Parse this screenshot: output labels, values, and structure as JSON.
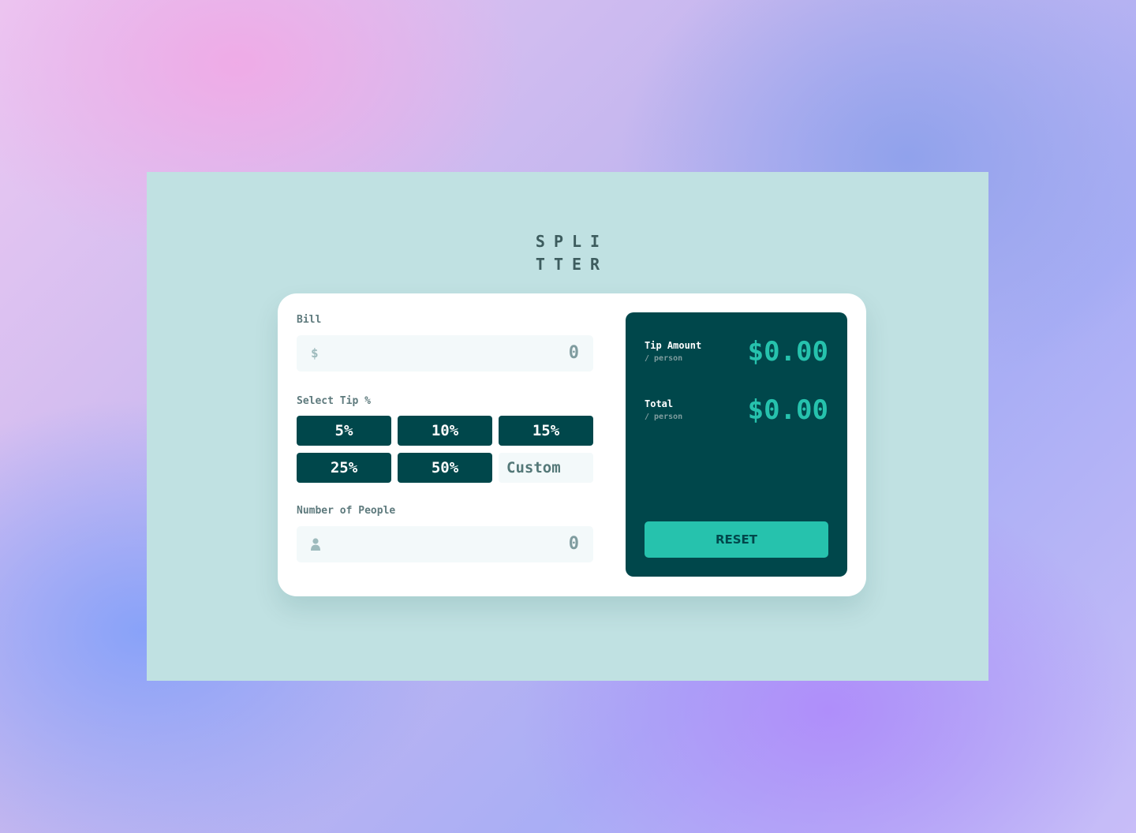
{
  "app": {
    "logo_line1": "SPLI",
    "logo_line2": "TTER"
  },
  "bill": {
    "label": "Bill",
    "currency_symbol": "$",
    "value": "0"
  },
  "tip": {
    "label": "Select Tip %",
    "options": [
      "5%",
      "10%",
      "15%",
      "25%",
      "50%"
    ],
    "custom_placeholder": "Custom"
  },
  "people": {
    "label": "Number of People",
    "icon": "person-icon",
    "value": "0"
  },
  "results": {
    "tip_amount": {
      "title": "Tip Amount",
      "subtitle": "/ person",
      "value": "$0.00"
    },
    "total": {
      "title": "Total",
      "subtitle": "/ person",
      "value": "$0.00"
    }
  },
  "reset_label": "RESET",
  "colors": {
    "dark_cyan": "#00474b",
    "strong_cyan": "#26c2ad",
    "light_cyan_bg": "#c0e1e2",
    "input_bg": "#f3f9fa",
    "label_text": "#5e7a7d"
  }
}
